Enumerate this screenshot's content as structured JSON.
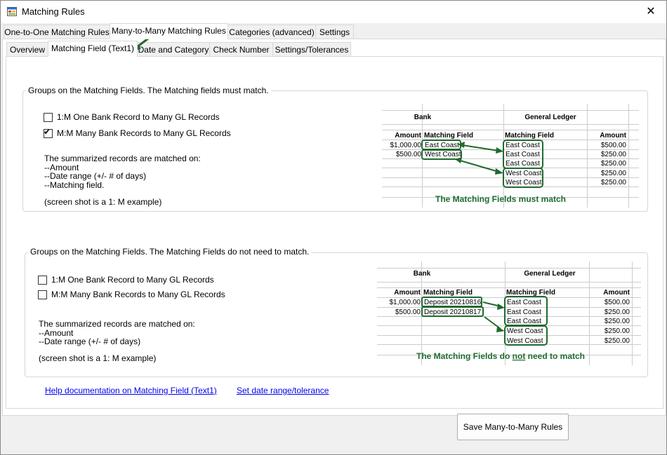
{
  "window": {
    "title": "Matching Rules",
    "close_glyph": "✕",
    "app_icon": "form-app-icon"
  },
  "top_tabs": [
    "One-to-One Matching Rules",
    "Many-to-Many Matching Rules",
    "Categories (advanced)",
    "Settings"
  ],
  "sub_tabs": [
    "Overview",
    "Matching Field (Text1)",
    "Date and Category",
    "Check Number",
    "Settings/Tolerances"
  ],
  "group1": {
    "title": "Groups on the Matching Fields. The Matching fields must match.",
    "option1": "1:M One Bank Record to Many GL Records",
    "option1_checked": false,
    "option2": "M:M Many Bank Records to Many GL Records",
    "option2_checked": true,
    "summary_lines": [
      "The summarized records are matched on:",
      "--Amount",
      "--Date range (+/- # of days)",
      "--Matching field."
    ],
    "note": "(screen shot is a 1: M example)",
    "sheet": {
      "bank_header": "Bank",
      "gl_header": "General Ledger",
      "amount_header": "Amount",
      "matching_field_header": "Matching Field",
      "gl_matching_field_header": "Matching Field",
      "gl_amount_header": "Amount",
      "bank_rows": [
        {
          "amount": "$1,000.00",
          "field": "East Coast"
        },
        {
          "amount": "$500.00",
          "field": "West Coast"
        }
      ],
      "gl_rows": [
        {
          "field": "East Coast",
          "amount": "$500.00"
        },
        {
          "field": "East Coast",
          "amount": "$250.00"
        },
        {
          "field": "East Coast",
          "amount": "$250.00"
        },
        {
          "field": "West Coast",
          "amount": "$250.00"
        },
        {
          "field": "West Coast",
          "amount": "$250.00"
        }
      ],
      "caption": "The Matching Fields must match"
    }
  },
  "group2": {
    "title": "Groups on the Matching Fields.  The Matching Fields do not need to match.",
    "option1": "1:M One Bank Record to Many GL Records",
    "option1_checked": false,
    "option2": "M:M Many Bank Records to Many GL Records",
    "option2_checked": false,
    "summary_lines": [
      "The summarized records are matched on:",
      "--Amount",
      "--Date range (+/- # of days)"
    ],
    "note": "(screen shot is a 1: M example)",
    "sheet": {
      "bank_header": "Bank",
      "gl_header": "General Ledger",
      "amount_header": "Amount",
      "matching_field_header": "Matching Field",
      "gl_matching_field_header": "Matching Field",
      "gl_amount_header": "Amount",
      "bank_rows": [
        {
          "amount": "$1,000.00",
          "field": "Deposit 20210816"
        },
        {
          "amount": "$500.00",
          "field": "Deposit 20210817"
        }
      ],
      "gl_rows": [
        {
          "field": "East Coast",
          "amount": "$500.00"
        },
        {
          "field": "East Coast",
          "amount": "$250.00"
        },
        {
          "field": "East Coast",
          "amount": "$250.00"
        },
        {
          "field": "West Coast",
          "amount": "$250.00"
        },
        {
          "field": "West Coast",
          "amount": "$250.00"
        }
      ],
      "caption_before": "The Matching Fields do ",
      "caption_emph": "not",
      "caption_after": " need to match"
    }
  },
  "links": {
    "help": "Help documentation on Matching Field (Text1)",
    "date_range": "Set date range/tolerance"
  },
  "save_button": "Save Many-to-Many Rules",
  "colors": {
    "accent_green": "#1e6b2e",
    "link_blue": "#0000ee",
    "grid_line": "#cccccc"
  }
}
